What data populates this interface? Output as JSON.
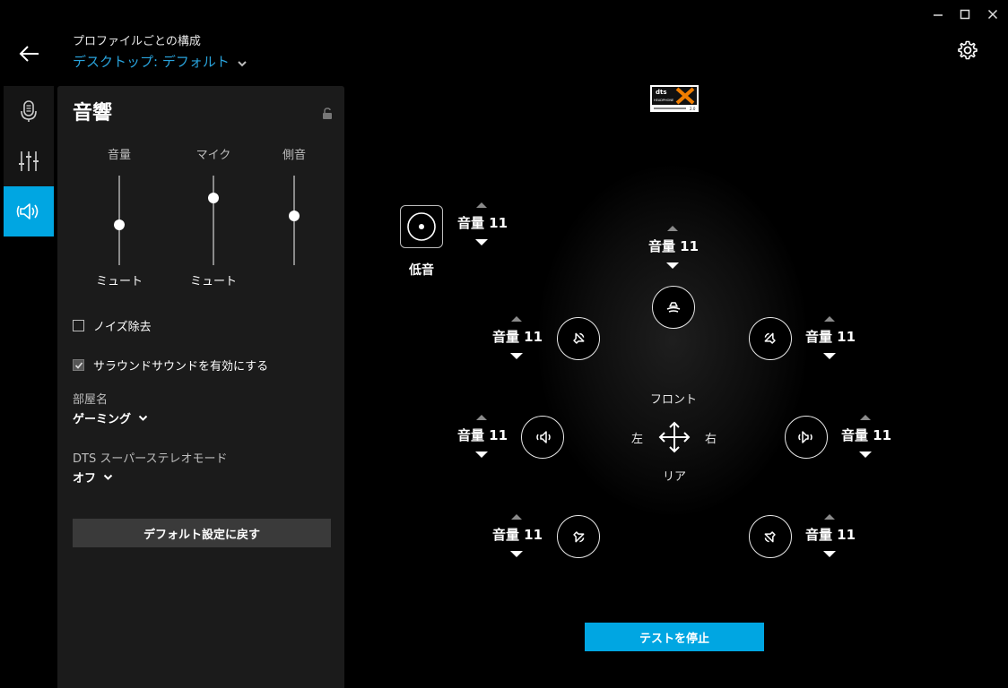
{
  "header": {
    "subtitle": "プロファイルごとの構成",
    "profile": "デスクトップ: デフォルト"
  },
  "colors": {
    "accent": "#00a6e2",
    "link": "#29a3dc",
    "panel": "#1b1b1b"
  },
  "rail": {
    "items": [
      {
        "icon": "microphone-icon",
        "active": false
      },
      {
        "icon": "equalizer-icon",
        "active": false
      },
      {
        "icon": "speaker-icon",
        "active": true
      }
    ]
  },
  "panel": {
    "title": "音響",
    "sliders": [
      {
        "label": "音量",
        "value_text": "ミュート",
        "level": 0.45
      },
      {
        "label": "マイク",
        "value_text": "ミュート",
        "level": 0.75
      },
      {
        "label": "側音",
        "value_text": "",
        "level": 0.55
      }
    ],
    "noise_reduction": {
      "label": "ノイズ除去",
      "checked": false
    },
    "surround": {
      "label": "サラウンドサウンドを有効にする",
      "checked": true
    },
    "room": {
      "label": "部屋名",
      "value": "ゲーミング"
    },
    "stereo_mode": {
      "label": "DTS スーパーステレオモード",
      "value": "オフ"
    },
    "reset_label": "デフォルト設定に戻す"
  },
  "stage": {
    "bass_label": "低音",
    "volume_label": "音量 11",
    "front_label": "フロント",
    "rear_label": "リア",
    "left_label": "左",
    "right_label": "右",
    "stop_label": "テストを停止"
  }
}
